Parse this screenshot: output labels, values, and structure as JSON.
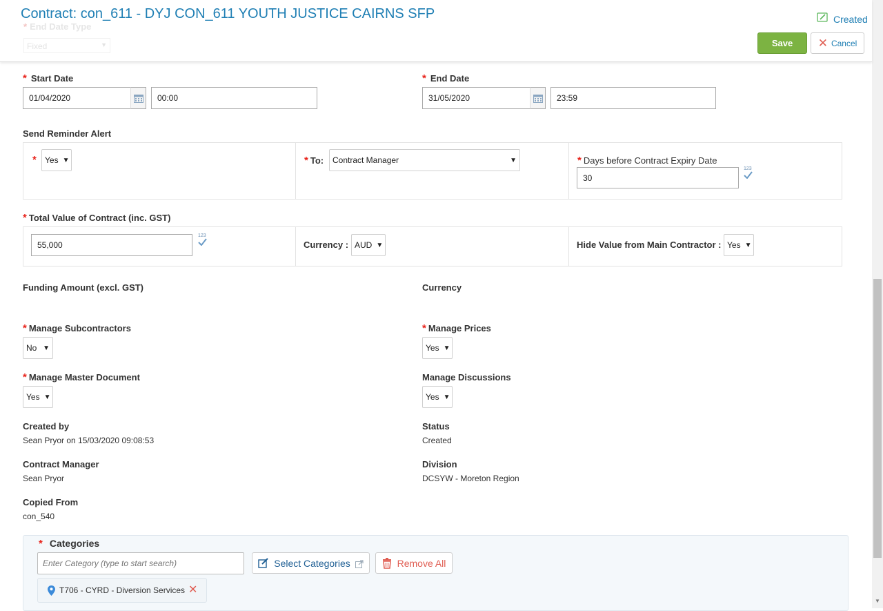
{
  "header": {
    "title": "Contract: con_611 - DYJ CON_611 YOUTH JUSTICE CAIRNS SFP",
    "status": "Created",
    "ghost_label": "End Date Type",
    "ghost_value": "Fixed",
    "save_label": "Save",
    "cancel_label": "Cancel"
  },
  "start": {
    "label": "Start Date",
    "date": "01/04/2020",
    "time": "00:00"
  },
  "end": {
    "label": "End Date",
    "date": "31/05/2020",
    "time": "23:59"
  },
  "reminder": {
    "label": "Send Reminder Alert",
    "enabled": "Yes",
    "to_label": "To:",
    "to_value": "Contract Manager",
    "days_label": "Days before Contract Expiry Date",
    "days_value": "30",
    "num_hint": "123"
  },
  "total": {
    "label": "Total Value of Contract (inc. GST)",
    "value": "55,000",
    "num_hint": "123",
    "currency_label": "Currency :",
    "currency_value": "AUD",
    "hide_label": "Hide Value from Main Contractor :",
    "hide_value": "Yes"
  },
  "funding": {
    "label": "Funding Amount (excl. GST)",
    "currency_label": "Currency"
  },
  "manage": {
    "subcontractors_label": "Manage Subcontractors",
    "subcontractors_value": "No",
    "prices_label": "Manage Prices",
    "prices_value": "Yes",
    "master_label": "Manage Master Document",
    "master_value": "Yes",
    "discussions_label": "Manage Discussions",
    "discussions_value": "Yes"
  },
  "info": {
    "created_by_label": "Created by",
    "created_by_value": "Sean Pryor on 15/03/2020 09:08:53",
    "status_label": "Status",
    "status_value": "Created",
    "manager_label": "Contract Manager",
    "manager_value": "Sean Pryor",
    "division_label": "Division",
    "division_value": "DCSYW - Moreton Region",
    "copied_label": "Copied From",
    "copied_value": "con_540"
  },
  "categories": {
    "label": "Categories",
    "placeholder": "Enter Category (type to start search)",
    "select_label": "Select Categories",
    "remove_label": "Remove All",
    "items": [
      {
        "label": "T706 - CYRD - Diversion Services"
      }
    ]
  },
  "colors": {
    "accent": "#1f7fb4",
    "save": "#7cb342",
    "required": "#e8231b",
    "remove": "#e05d52"
  }
}
